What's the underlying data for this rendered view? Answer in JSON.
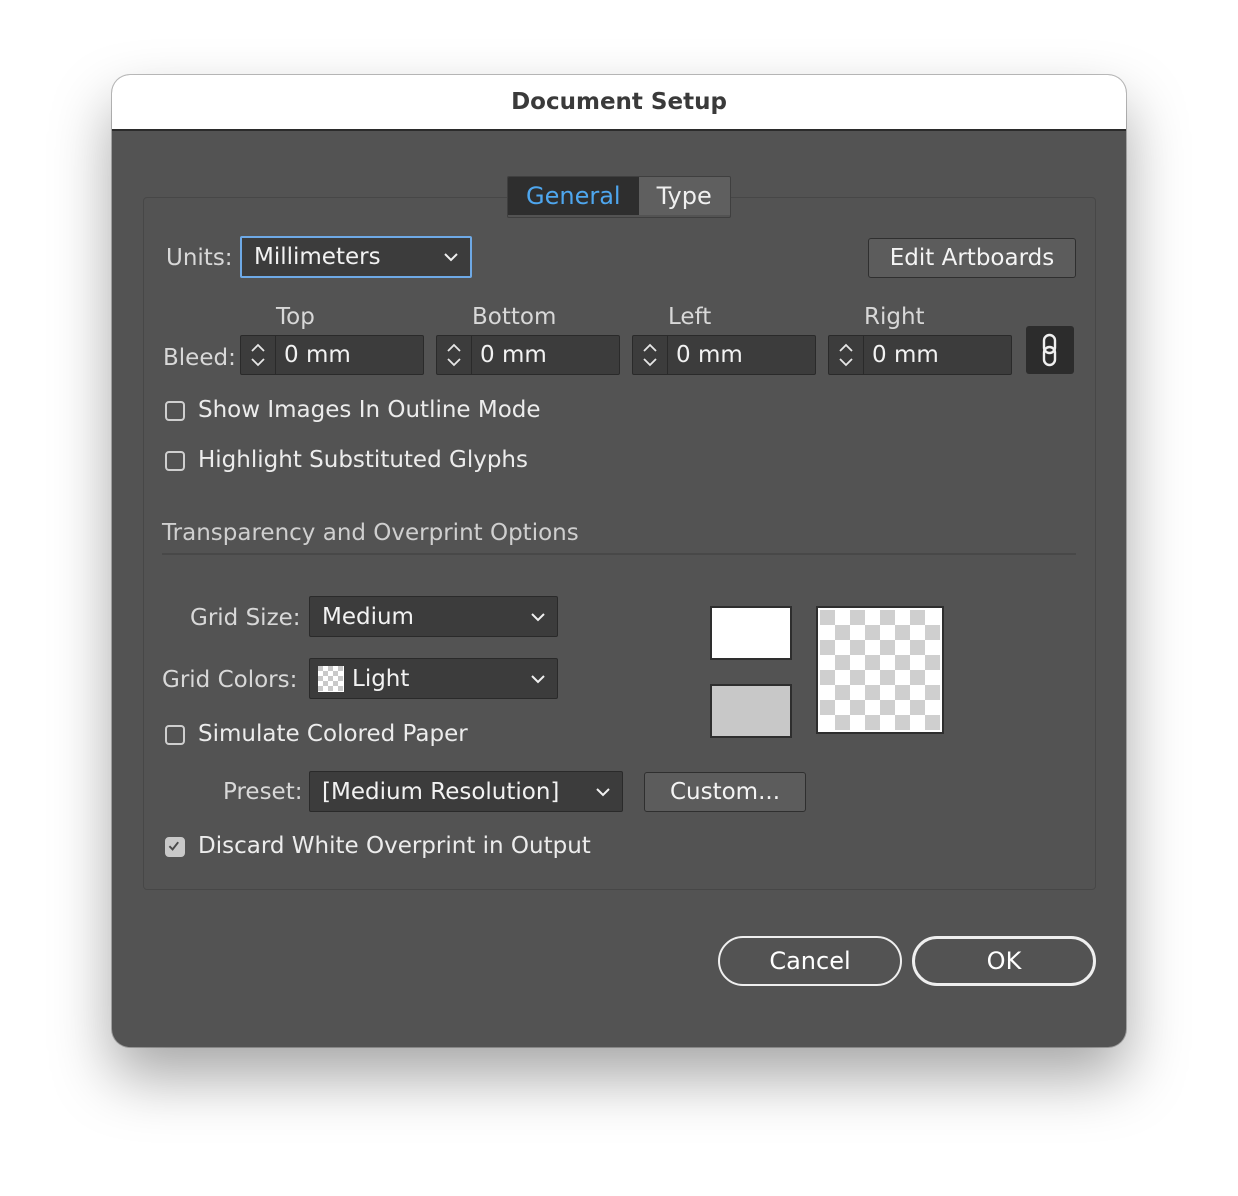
{
  "dialog": {
    "title": "Document Setup"
  },
  "tabs": [
    {
      "label": "General",
      "active": true
    },
    {
      "label": "Type",
      "active": false
    }
  ],
  "units": {
    "label": "Units:",
    "value": "Millimeters"
  },
  "edit_artboards": "Edit Artboards",
  "bleed": {
    "label": "Bleed:",
    "fields": [
      {
        "header": "Top",
        "value": "0 mm"
      },
      {
        "header": "Bottom",
        "value": "0 mm"
      },
      {
        "header": "Left",
        "value": "0 mm"
      },
      {
        "header": "Right",
        "value": "0 mm"
      }
    ],
    "link_icon": "link-icon"
  },
  "options": {
    "show_images_outline": {
      "label": "Show Images In Outline Mode",
      "checked": false
    },
    "highlight_glyphs": {
      "label": "Highlight Substituted Glyphs",
      "checked": false
    }
  },
  "transparency": {
    "section_title": "Transparency and Overprint Options",
    "grid_size": {
      "label": "Grid Size:",
      "value": "Medium"
    },
    "grid_colors": {
      "label": "Grid Colors:",
      "value": "Light"
    },
    "simulate_paper": {
      "label": "Simulate Colored Paper",
      "checked": false
    },
    "preset": {
      "label": "Preset:",
      "value": "[Medium Resolution]"
    },
    "custom_button": "Custom...",
    "discard_white": {
      "label": "Discard White Overprint in Output",
      "checked": true
    },
    "swatch_top_color": "#ffffff",
    "swatch_bottom_color": "#c8c8c8"
  },
  "buttons": {
    "cancel": "Cancel",
    "ok": "OK"
  },
  "colors": {
    "accent": "#4ea6ee",
    "dialog_bg": "#535353",
    "field_bg": "#3c3c3c"
  }
}
